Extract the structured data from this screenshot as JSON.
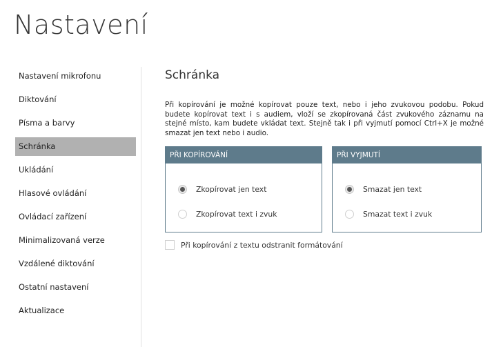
{
  "page": {
    "title": "Nastavení"
  },
  "sidebar": {
    "items": [
      {
        "label": "Nastavení mikrofonu",
        "active": false
      },
      {
        "label": "Diktování",
        "active": false
      },
      {
        "label": "Písma a barvy",
        "active": false
      },
      {
        "label": "Schránka",
        "active": true
      },
      {
        "label": "Ukládání",
        "active": false
      },
      {
        "label": "Hlasové ovládání",
        "active": false
      },
      {
        "label": "Ovládací zařízení",
        "active": false
      },
      {
        "label": "Minimalizovaná verze",
        "active": false
      },
      {
        "label": "Vzdálené diktování",
        "active": false
      },
      {
        "label": "Ostatní nastavení",
        "active": false
      },
      {
        "label": "Aktualizace",
        "active": false
      }
    ]
  },
  "main": {
    "section_title": "Schránka",
    "description": "Při kopírování je možné kopírovat pouze text, nebo i jeho zvukovou podobu. Pokud budete kopírovat text i s audiem, vloží se zkopírovaná část zvukového záznamu na stejné místo, kam budete vkládat text. Stejně tak i při vyjmutí pomocí Ctrl+X je možné smazat jen text nebo i audio.",
    "copy_group": {
      "header": "PŘI KOPÍROVÁNÍ",
      "options": [
        {
          "label": "Zkopírovat jen text",
          "selected": true
        },
        {
          "label": "Zkopírovat text i zvuk",
          "selected": false
        }
      ]
    },
    "cut_group": {
      "header": "PŘI VYJMUTÍ",
      "options": [
        {
          "label": "Smazat jen text",
          "selected": true
        },
        {
          "label": "Smazat text i zvuk",
          "selected": false
        }
      ]
    },
    "remove_formatting": {
      "label": "Při kopírování z textu odstranit formátování",
      "checked": false
    }
  },
  "colors": {
    "accent": "#5e7b8b",
    "active_nav": "#b1b1b1"
  }
}
